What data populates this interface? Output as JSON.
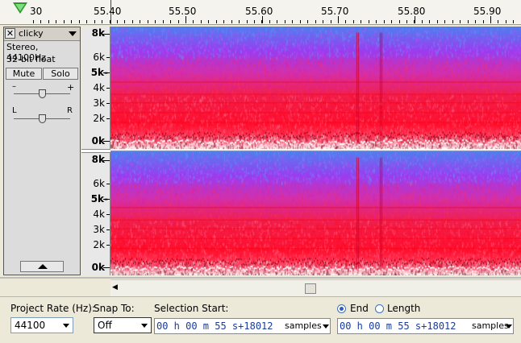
{
  "ruler": {
    "labels": [
      "30",
      "55.40",
      "55.50",
      "55.60",
      "55.70",
      "55.80",
      "55.90"
    ]
  },
  "track": {
    "name": "clicky",
    "info_line1": "Stereo, 44100Hz",
    "info_line2": "32-bit float",
    "mute_label": "Mute",
    "solo_label": "Solo",
    "gain_minus": "–",
    "gain_plus": "+",
    "pan_left": "L",
    "pan_right": "R",
    "close_glyph": "✕"
  },
  "freq_scale": {
    "top_channel": [
      "8k",
      "6k",
      "5k-",
      "4k",
      "3k",
      "2k",
      "0k"
    ],
    "bottom_channel": [
      "8k",
      "6k",
      "5k-",
      "4k",
      "3k",
      "2k",
      "0k"
    ]
  },
  "selection_toolbar": {
    "project_rate_label": "Project Rate (Hz):",
    "project_rate_value": "44100",
    "snap_to_label": "Snap To:",
    "snap_to_value": "Off",
    "selection_start_label": "Selection Start:",
    "end_label": "End",
    "length_label": "Length",
    "end_selected": true,
    "start_time": "00 h 00 m 55 s+18012",
    "end_time": "00 h 00 m 55 s+18012",
    "time_unit": "samples"
  },
  "colors": {
    "spectrogram_low": "#ffffff",
    "spectrogram_mid": "#ff1a3a",
    "spectrogram_high": "#9b3cf0",
    "spectrogram_top": "#3a8ef0",
    "timecode_digits": "#1a3c9c"
  }
}
